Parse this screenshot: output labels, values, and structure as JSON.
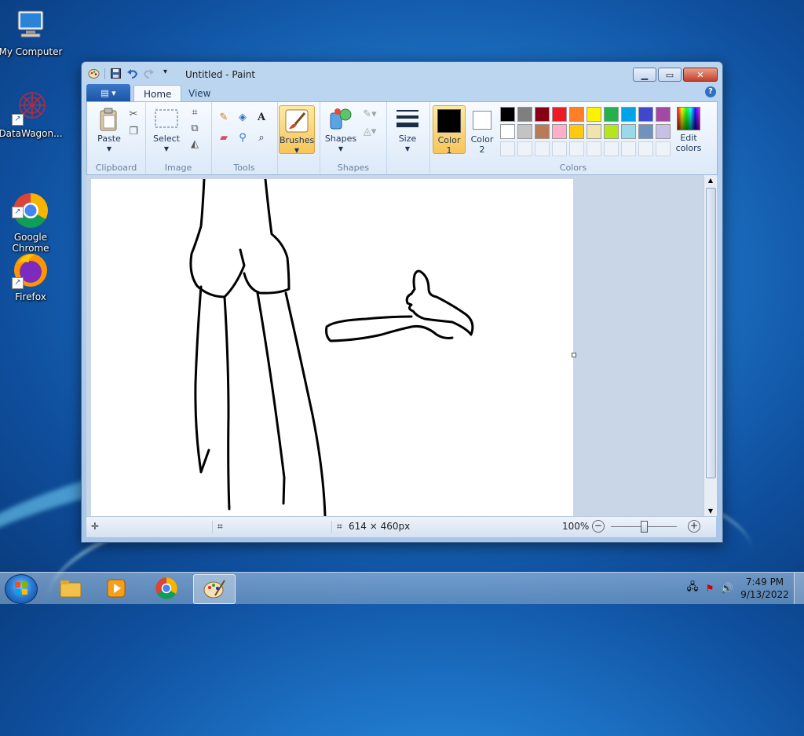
{
  "desktop": {
    "icons": [
      {
        "label": "My Computer"
      },
      {
        "label": "DataWagon..."
      },
      {
        "label": "Google\nChrome"
      },
      {
        "label": "Firefox"
      }
    ]
  },
  "window": {
    "title": "Untitled - Paint",
    "tabs": [
      {
        "label": "Home"
      },
      {
        "label": "View"
      }
    ],
    "help": "?"
  },
  "ribbon": {
    "clipboard": {
      "paste": "Paste",
      "group": "Clipboard"
    },
    "image": {
      "select": "Select",
      "group": "Image"
    },
    "tools": {
      "group": "Tools",
      "text_tool": "A"
    },
    "brushes": {
      "label": "Brushes"
    },
    "shapes": {
      "label": "Shapes",
      "group": "Shapes"
    },
    "size": {
      "label": "Size"
    },
    "colors": {
      "color1_line1": "Color",
      "color1_line2": "1",
      "color2_line1": "Color",
      "color2_line2": "2",
      "edit_line1": "Edit",
      "edit_line2": "colors",
      "group": "Colors",
      "color1": "#000000",
      "color2": "#ffffff",
      "row1": [
        "#000000",
        "#7f7f7f",
        "#880015",
        "#ed1c24",
        "#ff7f27",
        "#fff200",
        "#22b14c",
        "#00a2e8",
        "#3f48cc",
        "#a349a4"
      ],
      "row2": [
        "#ffffff",
        "#c3c3c3",
        "#b97a57",
        "#ffaec9",
        "#ffc90e",
        "#efe4b0",
        "#b5e61d",
        "#99d9ea",
        "#7092be",
        "#c8bfe7"
      ]
    }
  },
  "status": {
    "size": "614 × 460px",
    "zoom": "100%"
  },
  "taskbar": {
    "time": "7:49 PM",
    "date": "9/13/2022"
  }
}
